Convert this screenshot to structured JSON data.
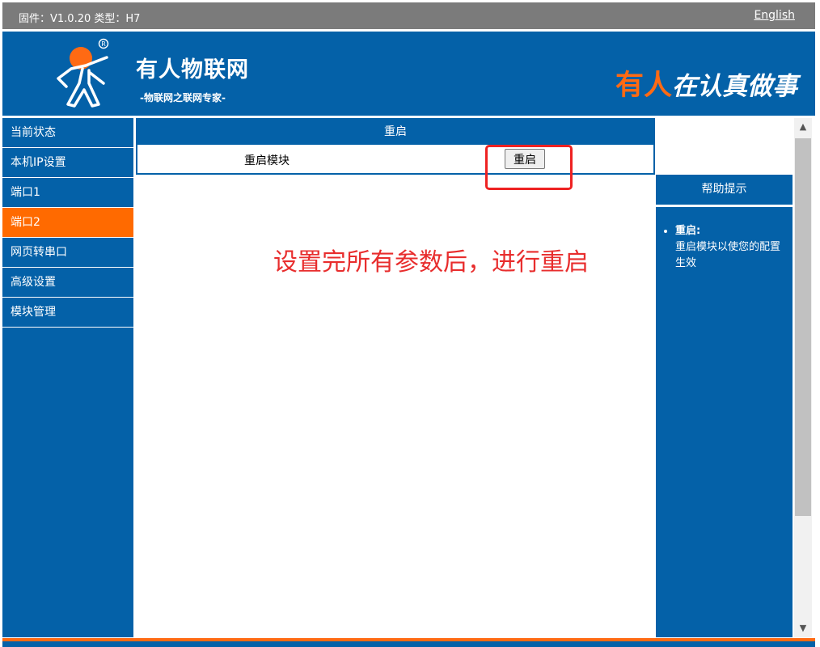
{
  "topbar": {
    "firmware": "固件：V1.0.20 类型：H7",
    "language_link": "English"
  },
  "header": {
    "company_name": "有人物联网",
    "slogan": "-物联网之联网专家-",
    "tagline_part1": "有人",
    "tagline_part2": "在认真做事"
  },
  "sidebar": {
    "items": [
      {
        "label": "当前状态"
      },
      {
        "label": "本机IP设置"
      },
      {
        "label": "端口1"
      },
      {
        "label": "端口2"
      },
      {
        "label": "网页转串口"
      },
      {
        "label": "高级设置"
      },
      {
        "label": "模块管理"
      }
    ],
    "active_index": 3
  },
  "main": {
    "panel_title": "重启",
    "row_label": "重启模块",
    "restart_button": "重启",
    "annotation": "设置完所有参数后，进行重启"
  },
  "help": {
    "title": "帮助提示",
    "item_title": "重启:",
    "item_text": "重启模块以使您的配置生效"
  },
  "colors": {
    "primary_blue": "#0461a8",
    "accent_orange": "#ff6a13",
    "annotation_red": "#e82d2d"
  }
}
